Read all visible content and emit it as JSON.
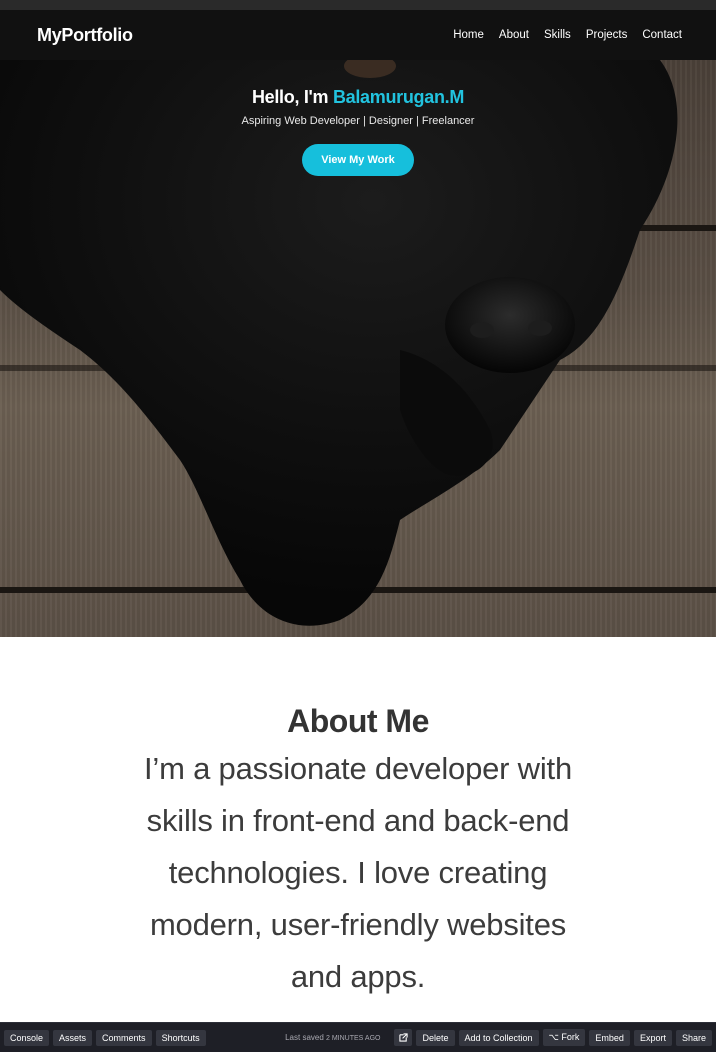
{
  "navbar": {
    "brand": "MyPortfolio",
    "links": [
      "Home",
      "About",
      "Skills",
      "Projects",
      "Contact"
    ]
  },
  "hero": {
    "greeting": "Hello, I'm ",
    "name": "Balamurugan.M",
    "subtitle": "Aspiring Web Developer | Designer | Freelancer",
    "cta_label": "View My Work"
  },
  "about": {
    "title": "About Me",
    "text": "I’m a passionate developer with skills in front-end and back-end technologies. I love creating modern, user-friendly websites and apps."
  },
  "bottombar": {
    "left_buttons": [
      "Console",
      "Assets",
      "Comments",
      "Shortcuts"
    ],
    "saved_prefix": "Last saved ",
    "saved_time": "2 minutes ago",
    "external_icon": "external-link-icon",
    "right_buttons": [
      "Delete",
      "Add to Collection",
      "⌥ Fork",
      "Embed",
      "Export",
      "Share"
    ]
  },
  "colors": {
    "accent": "#16bfdc",
    "navbar_bg": "#111111",
    "bottombar_bg": "#1e1f26"
  }
}
